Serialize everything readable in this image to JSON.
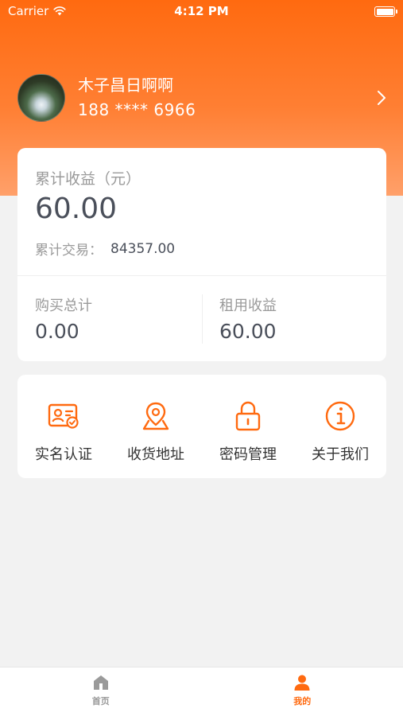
{
  "status_bar": {
    "carrier": "Carrier",
    "time": "4:12 PM"
  },
  "profile": {
    "name": "木子昌日啊啊",
    "phone": "188 **** 6966"
  },
  "stats": {
    "total_earnings_label": "累计收益（元）",
    "total_earnings_value": "60.00",
    "total_trade_label": "累计交易：",
    "total_trade_value": "84357.00",
    "purchase_total_label": "购买总计",
    "purchase_total_value": "0.00",
    "rental_earnings_label": "租用收益",
    "rental_earnings_value": "60.00"
  },
  "menu": {
    "items": [
      {
        "label": "实名认证",
        "icon": "id-card-icon"
      },
      {
        "label": "收货地址",
        "icon": "location-pin-icon"
      },
      {
        "label": "密码管理",
        "icon": "lock-icon"
      },
      {
        "label": "关于我们",
        "icon": "info-icon"
      }
    ]
  },
  "tab_bar": {
    "tabs": [
      {
        "label": "首页",
        "icon": "home-icon",
        "active": false
      },
      {
        "label": "我的",
        "icon": "user-icon",
        "active": true
      }
    ]
  },
  "colors": {
    "accent": "#ff6a10",
    "background": "#f2f2f2",
    "card": "#ffffff",
    "text_muted": "#9a9a9a",
    "text_value": "#4a4f5a"
  }
}
